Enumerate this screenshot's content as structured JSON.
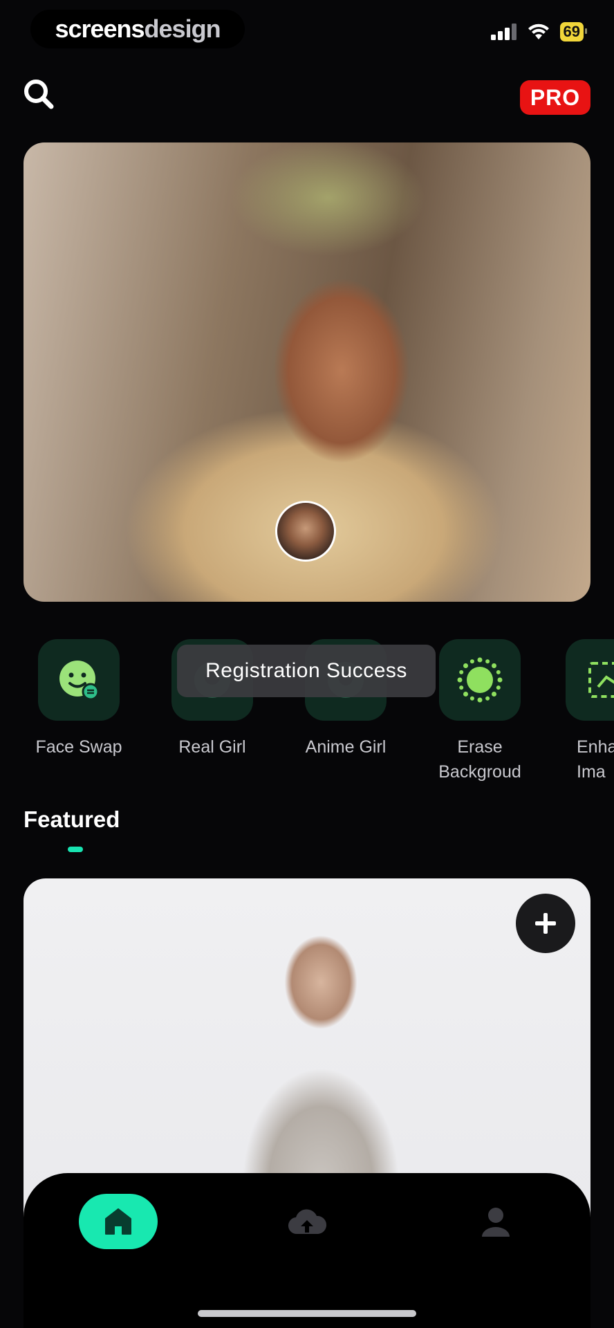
{
  "status_bar": {
    "brand_part1": "screens",
    "brand_part2": "design",
    "battery": "69"
  },
  "header": {
    "search_icon": "search-icon",
    "pro_label": "PRO"
  },
  "tools": [
    {
      "label": "Face Swap",
      "icon": "face-swap-icon"
    },
    {
      "label": "Real Girl",
      "icon": "real-girl-icon"
    },
    {
      "label": "Anime Girl",
      "icon": "anime-girl-icon"
    },
    {
      "label": "Erase\nBackgroud",
      "icon": "erase-background-icon"
    },
    {
      "label": "Enha\nIma",
      "icon": "enhance-image-icon"
    }
  ],
  "toast": "Registration Success",
  "featured": {
    "title": "Featured"
  },
  "tabbar": {
    "tabs": [
      "home",
      "upload",
      "profile"
    ],
    "active": "home"
  },
  "colors": {
    "accent": "#18e8b0",
    "pro": "#e81313",
    "background": "#060608"
  }
}
